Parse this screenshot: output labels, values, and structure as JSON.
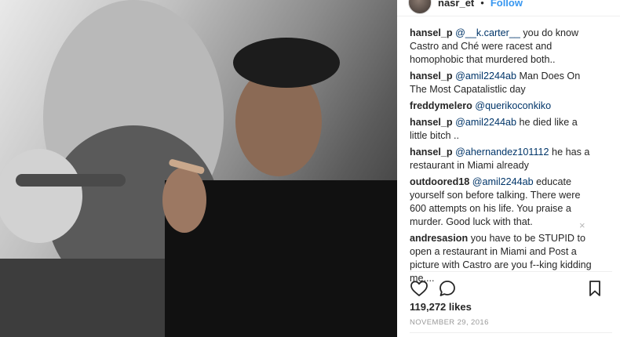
{
  "header": {
    "username": "nasr_et",
    "separator": "•",
    "follow_label": "Follow"
  },
  "comments": [
    {
      "user": "hansel_p",
      "mention": "@__k.carter__",
      "text": " you do know Castro and Ché were racest and homophobic that murdered both.."
    },
    {
      "user": "hansel_p",
      "mention": "@amil2244ab",
      "text": " Man Does On The Most Capatalistlic day"
    },
    {
      "user": "freddymelero",
      "mention": "@querikoconkiko",
      "text": ""
    },
    {
      "user": "hansel_p",
      "mention": "@amil2244ab",
      "text": " he died like a little bitch .."
    },
    {
      "user": "hansel_p",
      "mention": "@ahernandez101112",
      "text": " he has a restaurant in Miami already"
    },
    {
      "user": "outdoored18",
      "mention": "@amil2244ab",
      "text": " educate yourself son before talking. There were 600 attempts on his life. You praise a murder. Good luck with that."
    },
    {
      "user": "andresasion",
      "mention": "",
      "text": " you have to be STUPID to open a restaurant in Miami and Post a picture with Castro are you f--king kidding me...."
    }
  ],
  "close_symbol": "×",
  "likes": "119,272 likes",
  "date": "NOVEMBER 29, 2016",
  "icons": {
    "like": "heart-icon",
    "comment": "comment-icon",
    "save": "bookmark-icon"
  },
  "colors": {
    "mention": "#003569",
    "follow": "#3897f0",
    "meta": "#999999"
  }
}
